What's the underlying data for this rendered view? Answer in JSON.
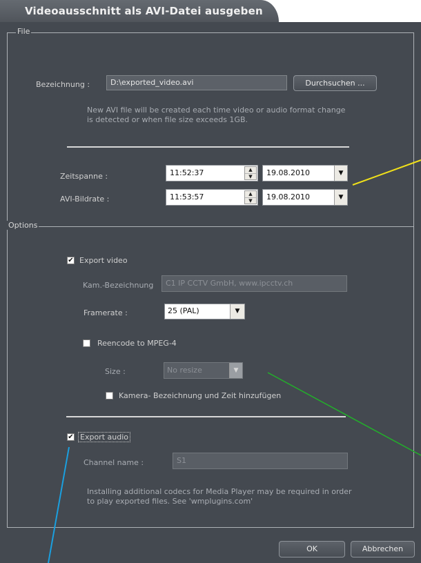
{
  "title": "Videoausschnitt als AVI-Datei ausgeben",
  "file_group": {
    "legend": "File",
    "bezeichnung_label": "Bezeichnung :",
    "path_value": "D:\\exported_video.avi",
    "browse_label": "Durchsuchen ...",
    "info_line1": "New AVI file will be created each time video or audio format change",
    "info_line2": "is detected or when file size exceeds 1GB.",
    "zeitspanne_label": "Zeitspanne :",
    "zeitspanne_time": "11:52:37",
    "zeitspanne_date": "19.08.2010",
    "bildrate_label": "AVI-Bildrate :",
    "bildrate_time": "11:53:57",
    "bildrate_date": "19.08.2010"
  },
  "options_group": {
    "legend": "Options",
    "export_video_label": "Export video",
    "export_video_checked": true,
    "kam_label": "Kam.-Bezeichnung",
    "kam_value": "C1 IP CCTV GmbH, www.ipcctv.ch",
    "framerate_label": "Framerate :",
    "framerate_value": "25 (PAL)",
    "reencode_label": "Reencode to MPEG-4",
    "reencode_checked": false,
    "size_label": "Size :",
    "size_value": "No resize",
    "kamera_zeit_label": "Kamera- Bezeichnung und Zeit hinzufügen",
    "kamera_zeit_checked": false,
    "export_audio_label": "Export audio",
    "export_audio_checked": true,
    "channel_label": "Channel name :",
    "channel_value": "S1",
    "codec_line1": "Installing additional codecs for Media Player may be required in order",
    "codec_line2": "to play exported files. See 'wmplugins.com'"
  },
  "buttons": {
    "ok": "OK",
    "cancel": "Abbrechen"
  },
  "glyphs": {
    "check": "✔",
    "spin_up": "▲",
    "spin_down": "▼",
    "dropdown": "▼"
  },
  "annotation_colors": {
    "yellow": "#f0e01a",
    "green": "#22b02a",
    "blue": "#1aa0e0"
  }
}
